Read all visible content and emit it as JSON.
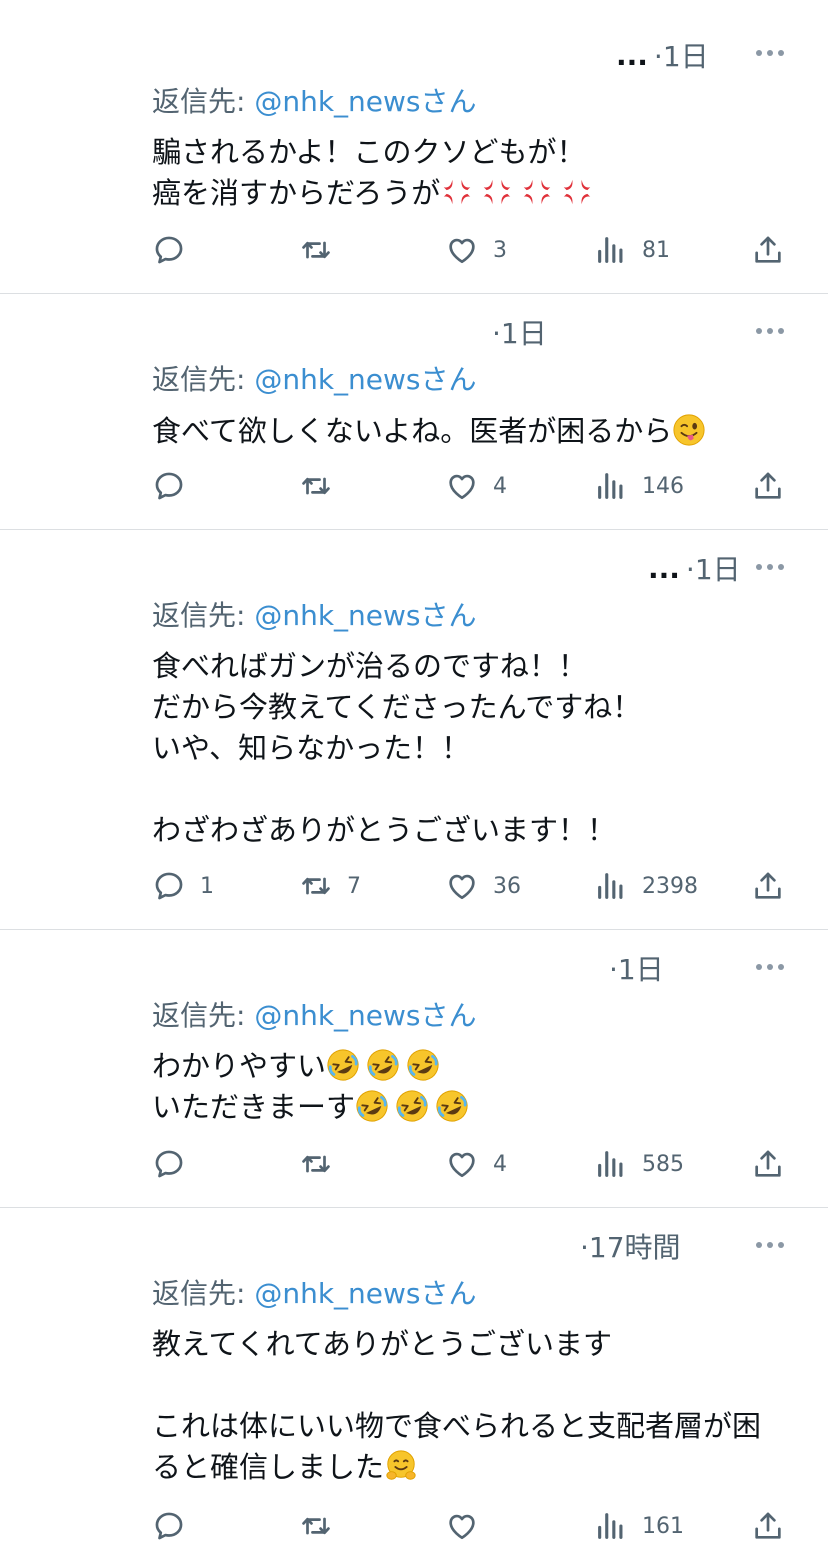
{
  "colors": {
    "text": "#0f1419",
    "muted": "#536471",
    "link": "#3b8ed0",
    "divider": "#dcdfe2"
  },
  "reply_prefix": "返信先: ",
  "handle": "@nhk_news",
  "handle_suffix": "さん",
  "tweets": [
    {
      "meta_dots": "...",
      "time": "·1日",
      "text": "騙されるかよ！このクソどもが！\n癌を消すからだろうが",
      "emojis": [
        "anger-emoji",
        "anger-emoji",
        "anger-emoji",
        "anger-emoji"
      ],
      "reply_count": "",
      "retweet_count": "",
      "like_count": "3",
      "view_count": "81"
    },
    {
      "meta_dots": "",
      "time": "·1日",
      "text": "食べて欲しくないよね。医者が困るから",
      "emojis": [
        "winking-tongue-emoji"
      ],
      "reply_count": "",
      "retweet_count": "",
      "like_count": "4",
      "view_count": "146"
    },
    {
      "meta_dots": "...",
      "time": "·1日",
      "text": "食べればガンが治るのですね！！\nだから今教えてくださったんですね！\nいや、知らなかった！！\n\nわざわざありがとうございます！！",
      "emojis": [],
      "reply_count": "1",
      "retweet_count": "7",
      "like_count": "36",
      "view_count": "2398"
    },
    {
      "meta_dots": "",
      "time": "·1日",
      "line1": "わかりやすい",
      "line2": "いただきまーす",
      "emojis": [
        "rofl-emoji",
        "rofl-emoji",
        "rofl-emoji"
      ],
      "reply_count": "",
      "retweet_count": "",
      "like_count": "4",
      "view_count": "585"
    },
    {
      "meta_dots": "",
      "time": "·17時間",
      "text": "教えてくれてありがとうございます\n\nこれは体にいい物で食べられると支配者層が困\nると確信しました",
      "emojis": [
        "hugging-emoji"
      ],
      "reply_count": "",
      "retweet_count": "",
      "like_count": "",
      "view_count": "161"
    }
  ]
}
